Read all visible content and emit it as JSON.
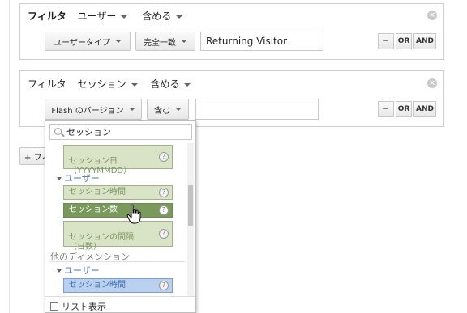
{
  "filter1": {
    "label": "フィルタ",
    "type": "ユーザー",
    "condition": "含める",
    "dimension_button": "ユーザータイプ",
    "match_button": "完全一致",
    "value": "Returning Visitor"
  },
  "filter2": {
    "label": "フィルタ",
    "type": "セッション",
    "condition": "含める",
    "dimension_button": "Flash のバージョン",
    "match_button": "含む",
    "value": ""
  },
  "logic_buttons": {
    "minus": "−",
    "or": "OR",
    "and": "AND"
  },
  "add_filter_label": "+ フィ",
  "dropdown": {
    "search_value": "セッション",
    "item_top": "セッション日\n（YYYYMMDD）",
    "group_user": "ユーザー",
    "item_session_time": "セッション時間",
    "item_session_count": "セッション数",
    "item_interval": "セッションの間隔\n（日数）",
    "section_other": "他のディメンション",
    "group_user2": "ユーザー",
    "item_session_time2": "セッション時間",
    "list_view": "リスト表示"
  },
  "colors": {
    "selected_item": "#7a9a5b",
    "item_bg": "#d8e4c5",
    "blue_item": "#b9d0ef"
  }
}
